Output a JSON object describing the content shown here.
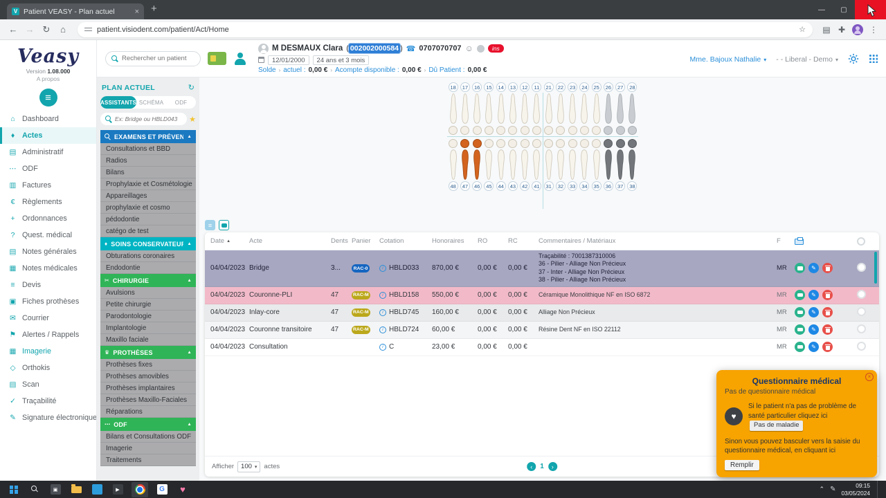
{
  "browser": {
    "tab_title": "Patient VEASY - Plan actuel",
    "url": "patient.visiodent.com/patient/Act/Home"
  },
  "sidebar": {
    "logo_text": "Veasy",
    "version_prefix": "Version",
    "version_number": "1.08.000",
    "about": "A propos",
    "items": [
      {
        "label": "Dashboard",
        "icon": "dashboard"
      },
      {
        "label": "Actes",
        "icon": "tooth",
        "active": true
      },
      {
        "label": "Administratif",
        "icon": "card"
      },
      {
        "label": "ODF",
        "icon": "dots"
      },
      {
        "label": "Factures",
        "icon": "invoice"
      },
      {
        "label": "Règlements",
        "icon": "euro"
      },
      {
        "label": "Ordonnances",
        "icon": "prescription"
      },
      {
        "label": "Quest. médical",
        "icon": "question"
      },
      {
        "label": "Notes générales",
        "icon": "note"
      },
      {
        "label": "Notes médicales",
        "icon": "note-medical"
      },
      {
        "label": "Devis",
        "icon": "devis"
      },
      {
        "label": "Fiches prothèses",
        "icon": "fiche"
      },
      {
        "label": "Courrier",
        "icon": "mail"
      },
      {
        "label": "Alertes / Rappels",
        "icon": "flag"
      },
      {
        "label": "Imagerie",
        "icon": "image",
        "accent": true
      },
      {
        "label": "Orthokis",
        "icon": "ortho"
      },
      {
        "label": "Scan",
        "icon": "scan"
      },
      {
        "label": "Traçabilité",
        "icon": "trace"
      },
      {
        "label": "Signature électronique",
        "icon": "signature"
      }
    ]
  },
  "plan_panel": {
    "title": "PLAN ACTUEL",
    "tabs": [
      {
        "label": "ASSISTANTS",
        "active": true
      },
      {
        "label": "SCHÉMA",
        "active": false
      },
      {
        "label": "ODF",
        "active": false
      }
    ],
    "search_placeholder": "Ex: Bridge ou HBLD043",
    "sections": [
      {
        "label": "EXAMENS ET PRÉVENTION",
        "color": "#1a79c0",
        "icon": "magnifier",
        "items": [
          "Consultations et BBD",
          "Radios",
          "Bilans",
          "Prophylaxie et Cosmétologie",
          "Appareillages",
          "prophylaxie et cosmo",
          "pédodontie",
          "catégo de test"
        ]
      },
      {
        "label": "SOINS CONSERVATEURS",
        "color": "#00b4c3",
        "icon": "tooth",
        "items": [
          "Obturations coronaires",
          "Endodontie"
        ]
      },
      {
        "label": "CHIRURGIE",
        "color": "#2fb457",
        "icon": "scalpel",
        "items": [
          "Avulsions",
          "Petite chirurgie",
          "Parodontologie",
          "Implantologie",
          "Maxillo faciale"
        ]
      },
      {
        "label": "PROTHÈSES",
        "color": "#2fb457",
        "icon": "crown",
        "items": [
          "Prothèses fixes",
          "Prothèses amovibles",
          "Prothèses implantaires",
          "Prothèses Maxillo-Faciales",
          "Réparations"
        ]
      },
      {
        "label": "ODF",
        "color": "#2fb457",
        "icon": "dots",
        "items": [
          "Bilans et Consultations ODF",
          "Imagerie",
          "Traitements"
        ]
      }
    ]
  },
  "header": {
    "search_placeholder": "Rechercher un patient",
    "patient": {
      "name": "M DESMAUX Clara",
      "id": "002002000584",
      "phone": "0707070707",
      "ins": "ins",
      "birth_date": "12/01/2000",
      "age": "24 ans et 3 mois"
    },
    "balance": {
      "solde_label": "Solde",
      "actuel_label": "actuel :",
      "actuel_value": "0,00 €",
      "acompte_label": "Acompte disponible :",
      "acompte_value": "0,00 €",
      "du_label": "Dû Patient :",
      "du_value": "0,00 €"
    },
    "practitioner": "Mme. Bajoux Nathalie",
    "structure": "- - Liberal - Demo"
  },
  "dental_chart": {
    "upper": [
      18,
      17,
      16,
      15,
      14,
      13,
      12,
      11,
      21,
      22,
      23,
      24,
      25,
      26,
      27,
      28
    ],
    "lower": [
      48,
      47,
      46,
      45,
      44,
      43,
      42,
      41,
      31,
      32,
      33,
      34,
      35,
      36,
      37,
      38
    ],
    "states": {
      "orange": [
        46,
        47
      ],
      "dark": [
        36,
        37,
        38
      ],
      "gray": [
        26,
        27,
        28
      ]
    }
  },
  "acts_table": {
    "columns": [
      "Date",
      "Acte",
      "Dents",
      "Panier",
      "Cotation",
      "Honoraires",
      "RO",
      "RC",
      "Commentaires / Matériaux",
      "F"
    ],
    "rows": [
      {
        "date": "04/04/2023",
        "acte": "Bridge",
        "dents": "3...",
        "panier": "RAC-0",
        "panier_type": "blue",
        "cotation": "HBLD033",
        "honoraires": "870,00 €",
        "ro": "0,00 €",
        "rc": "0,00 €",
        "commentaires": [
          "Traçabilité : 7001387310006",
          "36 - Pilier - Alliage Non Précieux",
          "37 - Inter - Alliage Non Précieux",
          "38 - Pilier - Alliage Non Précieux"
        ],
        "f": "MR",
        "variant": "selected"
      },
      {
        "date": "04/04/2023",
        "acte": "Couronne-PLI",
        "dents": "47",
        "panier": "RAC-M",
        "panier_type": "yellow",
        "cotation": "HBLD158",
        "honoraires": "550,00 €",
        "ro": "0,00 €",
        "rc": "0,00 €",
        "commentaires": [
          "Céramique Monolithique NF en ISO 6872"
        ],
        "f": "MR",
        "variant": "pink"
      },
      {
        "date": "04/04/2023",
        "acte": "Inlay-core",
        "dents": "47",
        "panier": "RAC-M",
        "panier_type": "yellow",
        "cotation": "HBLD745",
        "honoraires": "160,00 €",
        "ro": "0,00 €",
        "rc": "0,00 €",
        "commentaires": [
          "Alliage Non Précieux"
        ],
        "f": "MR",
        "variant": "gray"
      },
      {
        "date": "04/04/2023",
        "acte": "Couronne transitoire",
        "dents": "47",
        "panier": "RAC-M",
        "panier_type": "yellow",
        "cotation": "HBLD724",
        "honoraires": "60,00 €",
        "ro": "0,00 €",
        "rc": "0,00 €",
        "commentaires": [
          "Résine Dent NF en ISO 22112"
        ],
        "f": "MR",
        "variant": "light"
      },
      {
        "date": "04/04/2023",
        "acte": "Consultation",
        "dents": "",
        "panier": "",
        "panier_type": "",
        "cotation": "C",
        "honoraires": "23,00 €",
        "ro": "0,00 €",
        "rc": "0,00 €",
        "commentaires": [],
        "f": "MR",
        "variant": "white"
      }
    ],
    "footer": {
      "afficher": "Afficher",
      "per_page": "100",
      "actes": "actes",
      "page": "1"
    }
  },
  "questionnaire": {
    "title": "Questionnaire médical",
    "subtitle": "Pas de questionnaire médical",
    "line1": "Si le patient n'a pas de problème de santé particulier cliquez ici",
    "button1": "Pas de maladie",
    "line2": "Sinon vous pouvez basculer vers la saisie du questionnaire médical, en cliquant ici",
    "button2": "Remplir"
  },
  "taskbar": {
    "time": "09:15",
    "date": "03/05/2024"
  },
  "colors": {
    "teal": "#12a5ad",
    "blue": "#2b8fd9",
    "popup_orange": "#f7a300"
  }
}
